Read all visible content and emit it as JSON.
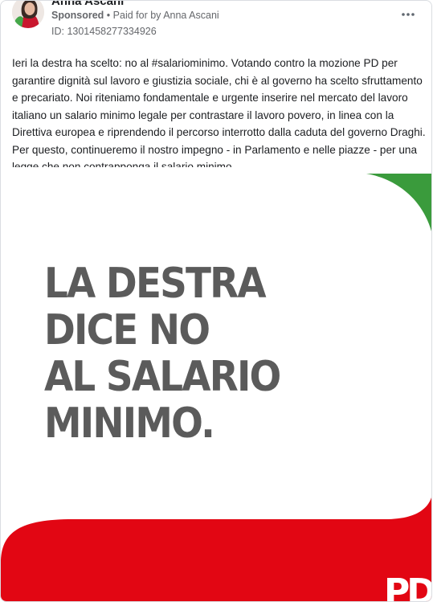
{
  "ad": {
    "advertiser": "Anna Ascani",
    "sponsored_label": "Sponsored",
    "paid_for": "Paid for by Anna Ascani",
    "separator": "•",
    "library_id": "ID: 1301458277334926",
    "body": "Ieri la destra ha scelto: no al #salariominimo. Votando contro la mozione PD per garantire dignità sul lavoro e giustizia sociale, chi è al governo ha scelto sfruttamento e precariato. Noi riteniamo fondamentale e urgente inserire nel mercato del lavoro italiano un salario minimo legale per contrastare il lavoro povero, in linea con la Direttiva europea e riprendendo il percorso interrotto dalla caduta del governo Draghi. Per questo, continueremo il nostro impegno - in Parlamento e nelle piazze - per una legge che non contrapponga il salario minimo..."
  },
  "creative": {
    "headline_lines": [
      "LA DESTRA",
      "DICE NO",
      "AL SALARIO",
      "MINIMO."
    ],
    "logo_text": "PD",
    "colors": {
      "green": "#3a9b3c",
      "red": "#e20613",
      "text": "#5b5b5b"
    }
  },
  "icons": {
    "more": "more-options-icon",
    "avatar": "avatar"
  }
}
